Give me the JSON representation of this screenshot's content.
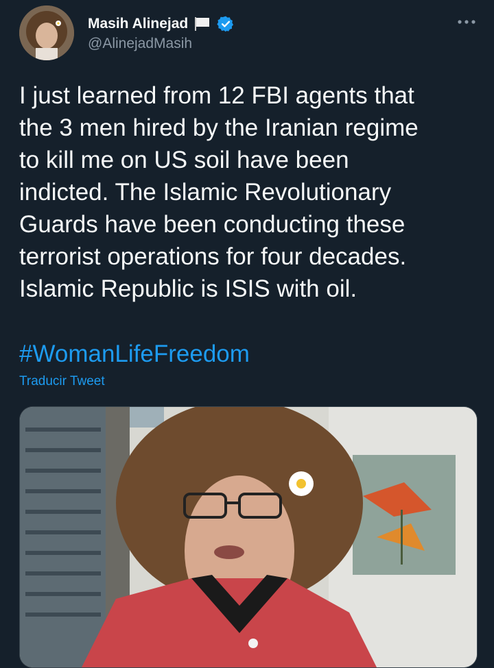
{
  "user": {
    "name": "Masih Alinejad",
    "handle": "@AlinejadMasih",
    "flag_icon": "white-flag-icon",
    "verified_icon": "verified-badge-icon",
    "verified_color": "#1d9bf0"
  },
  "tweet": {
    "text": "I just learned from 12 FBI agents that\nthe 3 men hired by the Iranian regime\nto kill me on US soil have been\nindicted. The Islamic Revolutionary\nGuards have been conducting these\nterrorist operations for four decades.\nIslamic Republic is ISIS with oil.",
    "hashtag": "#WomanLifeFreedom",
    "translate_label": "Traducir Tweet"
  },
  "colors": {
    "background": "#15202b",
    "text": "#f7f9f9",
    "secondary": "#8b98a5",
    "accent": "#1d9bf0"
  }
}
